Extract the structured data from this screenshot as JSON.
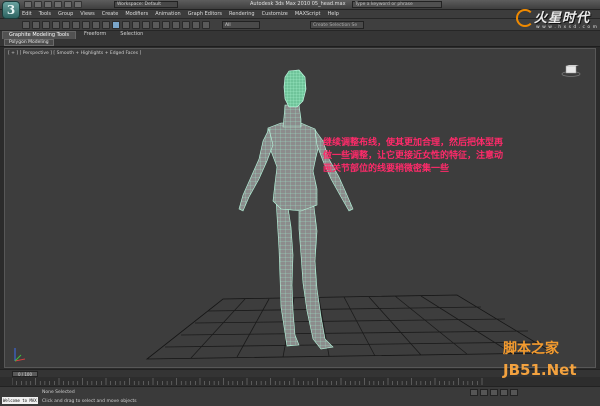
{
  "app": {
    "logo_letter": "3",
    "window_title": "Autodesk 3ds Max  2010    05_head.max",
    "workspace": "Workspace: Default",
    "search_placeholder": "Type a keyword or phrase"
  },
  "menu": [
    "Edit",
    "Tools",
    "Group",
    "Views",
    "Create",
    "Modifiers",
    "Animation",
    "Graph Editors",
    "Rendering",
    "Customize",
    "MAXScript",
    "Help"
  ],
  "toolbar": {
    "selection_filter": "All",
    "named_selection": "Create Selection Se"
  },
  "ribbon": {
    "tabs": [
      "Graphite Modeling Tools",
      "Freeform",
      "Selection"
    ],
    "active_panel": "Polygon Modeling"
  },
  "viewport": {
    "label": "[ + ] [ Perspective ] [ Smooth + Highlights + Edged Faces ]",
    "annotation_lines": [
      "继续调整布线，使其更加合理，然后把体型再",
      "做一些调整，让它更接近女性的特征，注意动",
      "画关节部位的线要稍微密集一些"
    ]
  },
  "brand": {
    "name": "火星时代",
    "url": "w w w . h x s d . c o m"
  },
  "watermark": {
    "line1": "脚本之家",
    "line2": "JB51.Net"
  },
  "timeline": {
    "frame": "0 / 100"
  },
  "status": {
    "maxscript": "Welcome to MAX",
    "line1": "None Selected",
    "line2": "Click and drag to select and move objects"
  },
  "colors": {
    "annotation": "#ff2a6a",
    "wireframe": "#9ef2d0",
    "brand_orange": "#f08a00"
  }
}
